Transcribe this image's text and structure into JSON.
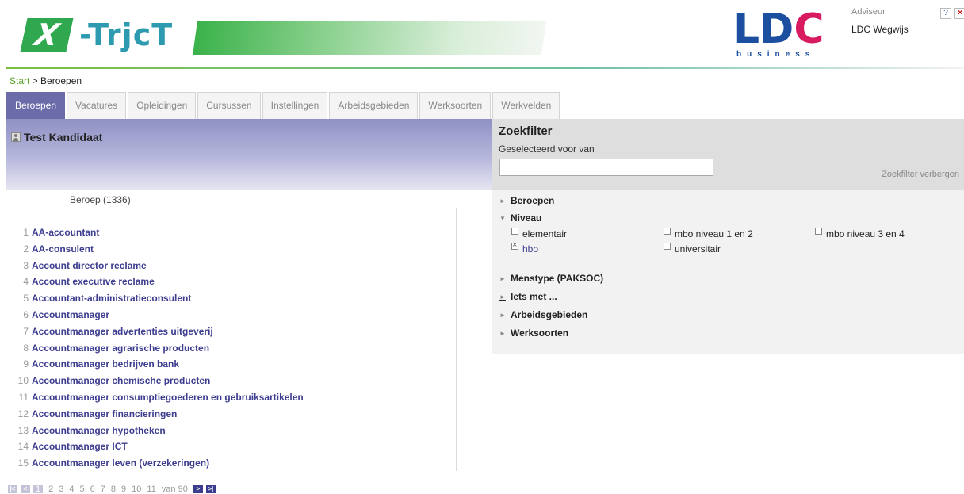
{
  "header": {
    "logo_x": "X",
    "logo_text": "-TrjcT",
    "ldc_L": "L",
    "ldc_D": "D",
    "ldc_C": "C",
    "ldc_sub": "business",
    "user_role": "Adviseur",
    "user_name": "LDC Wegwijs",
    "help_icon": "?",
    "close_icon": "×"
  },
  "breadcrumb": {
    "start": "Start",
    "separator": " > ",
    "current": "Beroepen"
  },
  "tabs": [
    {
      "label": "Beroepen",
      "active": true
    },
    {
      "label": "Vacatures"
    },
    {
      "label": "Opleidingen"
    },
    {
      "label": "Cursussen"
    },
    {
      "label": "Instellingen"
    },
    {
      "label": "Arbeidsgebieden"
    },
    {
      "label": "Werksoorten"
    },
    {
      "label": "Werkvelden"
    }
  ],
  "candidate": {
    "name": "Test Kandidaat"
  },
  "list": {
    "count_label": "Beroep (1336)",
    "items": [
      {
        "num": "1",
        "name": "AA-accountant"
      },
      {
        "num": "2",
        "name": "AA-consulent"
      },
      {
        "num": "3",
        "name": "Account director reclame"
      },
      {
        "num": "4",
        "name": "Account executive reclame"
      },
      {
        "num": "5",
        "name": "Accountant-administratieconsulent"
      },
      {
        "num": "6",
        "name": "Accountmanager"
      },
      {
        "num": "7",
        "name": "Accountmanager advertenties uitgeverij"
      },
      {
        "num": "8",
        "name": "Accountmanager agrarische producten"
      },
      {
        "num": "9",
        "name": "Accountmanager bedrijven bank"
      },
      {
        "num": "10",
        "name": "Accountmanager chemische producten"
      },
      {
        "num": "11",
        "name": "Accountmanager consumptiegoederen en gebruiksartikelen"
      },
      {
        "num": "12",
        "name": "Accountmanager financieringen"
      },
      {
        "num": "13",
        "name": "Accountmanager hypotheken"
      },
      {
        "num": "14",
        "name": "Accountmanager ICT"
      },
      {
        "num": "15",
        "name": "Accountmanager leven (verzekeringen)"
      }
    ]
  },
  "pager": {
    "first": "|<",
    "prev": "<",
    "pages": [
      "1",
      "2",
      "3",
      "4",
      "5",
      "6",
      "7",
      "8",
      "9",
      "10",
      "11"
    ],
    "current_page": "1",
    "of_label": "van 90",
    "next": ">",
    "last": ">|"
  },
  "filter": {
    "title": "Zoekfilter",
    "subtitle": "Geselecteerd voor van",
    "input_value": "",
    "hide_label": "Zoekfilter verbergen",
    "sections": {
      "beroepen": "Beroepen",
      "niveau": "Niveau",
      "menstype": "Menstype (PAKSOC)",
      "iets_met": "Iets met ...",
      "arbeidsgebieden": "Arbeidsgebieden",
      "werksoorten": "Werksoorten"
    },
    "niveau_options": {
      "elementair": {
        "label": "elementair",
        "checked": false
      },
      "mbo12": {
        "label": "mbo niveau 1 en 2",
        "checked": false
      },
      "mbo34": {
        "label": "mbo niveau 3 en 4",
        "checked": false
      },
      "hbo": {
        "label": "hbo",
        "checked": true
      },
      "universitair": {
        "label": "universitair",
        "checked": false
      }
    },
    "arrow_collapsed": "►",
    "arrow_expanded": "▼"
  },
  "colors": {
    "accent": "#6b6baa",
    "link": "#3d3d8f",
    "green": "#5aa02c",
    "brand_blue": "#1d4fa0",
    "brand_pink": "#d81b60"
  }
}
